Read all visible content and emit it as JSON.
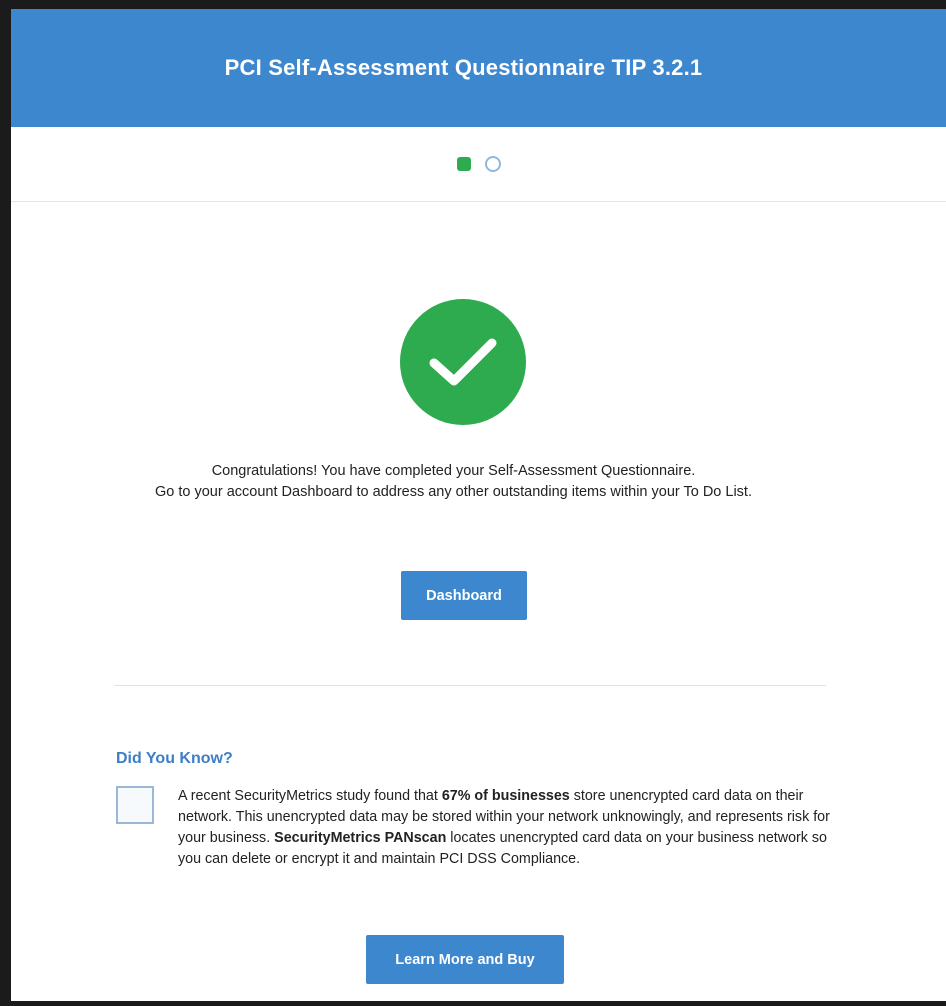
{
  "header": {
    "title": "PCI Self-Assessment Questionnaire TIP 3.2.1"
  },
  "steps": [
    {
      "state": "completed",
      "color": "#2eaa4f"
    },
    {
      "state": "pending",
      "color": "#8fb8de"
    }
  ],
  "completion": {
    "icon": "check-icon",
    "line1": "Congratulations! You have completed your Self-Assessment Questionnaire.",
    "line2": "Go to your account Dashboard to address any other outstanding items within your To Do List."
  },
  "dashboard_button": {
    "label": "Dashboard"
  },
  "did_you_know": {
    "title": "Did You Know?",
    "icon": "document-icon",
    "text_1": "A recent SecurityMetrics study found that ",
    "bold_1": "67% of businesses",
    "text_2": " store unencrypted card data on their network. This unencrypted data may be stored within your network unknowingly, and represents risk for your business. ",
    "bold_2": "SecurityMetrics PANscan",
    "text_3": " locates unencrypted card data on your business network so you can delete or encrypt it and maintain PCI DSS Compliance."
  },
  "learn_more_button": {
    "label": "Learn More and Buy"
  },
  "colors": {
    "brand_blue": "#3d87cf",
    "success_green": "#2eaa4f",
    "link_blue": "#3d7ec6"
  }
}
